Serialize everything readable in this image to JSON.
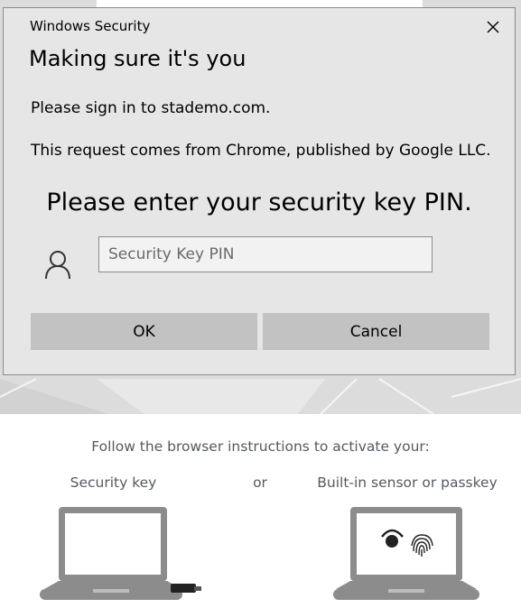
{
  "dialog": {
    "window_title": "Windows Security",
    "heading": "Making sure it's you",
    "sign_in_text": "Please sign in to stademo.com.",
    "request_text": "This request comes from Chrome, published by Google LLC.",
    "pin_prompt": "Please enter your security key PIN.",
    "pin_input": {
      "value": "",
      "placeholder": "Security Key PIN"
    },
    "ok_label": "OK",
    "cancel_label": "Cancel"
  },
  "page": {
    "instructions": "Follow the browser instructions to activate your:",
    "option_security_key": "Security key",
    "or_label": "or",
    "option_builtin": "Built-in sensor or passkey"
  },
  "colors": {
    "dialog_bg": "#e6e6e6",
    "button_bg": "#c2c2c2",
    "page_text": "#555a60",
    "laptop_grey": "#8c8c8c"
  }
}
